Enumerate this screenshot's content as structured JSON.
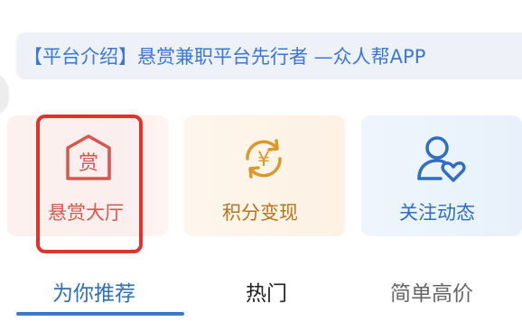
{
  "notice": {
    "text": "【平台介绍】悬赏兼职平台先行者 —众人帮APP"
  },
  "cards": [
    {
      "label": "悬赏大厅",
      "icon": "reward-house-icon",
      "icon_char": "赏",
      "color": "#d8574c"
    },
    {
      "label": "积分变现",
      "icon": "yen-exchange-icon",
      "icon_char": "¥",
      "color": "#d99a2b"
    },
    {
      "label": "关注动态",
      "icon": "user-heart-icon",
      "color": "#2e6fc4"
    }
  ],
  "tabs": [
    {
      "label": "为你推荐",
      "active": true
    },
    {
      "label": "热门",
      "active": false
    },
    {
      "label": "简单高价",
      "active": false
    }
  ],
  "colors": {
    "accent": "#3a7ac8",
    "highlight_border": "#e0332b"
  }
}
